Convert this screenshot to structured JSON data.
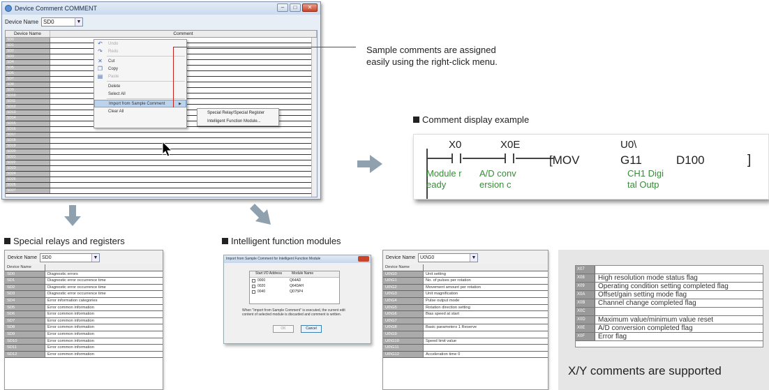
{
  "window": {
    "title": "Device Comment COMMENT",
    "device_name_label": "Device Name",
    "device_name_value": "SD0",
    "col_device": "Device Name",
    "col_comment": "Comment",
    "rows": [
      "SD0",
      "SD1",
      "SD2",
      "SD3",
      "SD4",
      "SD5",
      "SD6",
      "SD7",
      "SD8",
      "SD9",
      "SD10",
      "SD11",
      "SD12",
      "SD13",
      "SD14",
      "SD15",
      "SD16",
      "SD17",
      "SD18",
      "SD19",
      "SD20",
      "SD21",
      "SD22",
      "SD23",
      "SD24",
      "SD25",
      "SD26",
      "SD27"
    ]
  },
  "context_menu": {
    "items": [
      {
        "label": "Undo",
        "icon": "undo-icon",
        "glyph": "↶",
        "disabled": true
      },
      {
        "label": "Redo",
        "icon": "redo-icon",
        "glyph": "↷",
        "disabled": true
      },
      {
        "label": "Cut",
        "icon": "cut-icon",
        "glyph": "✕",
        "disabled": false
      },
      {
        "label": "Copy",
        "icon": "copy-icon",
        "glyph": "❐",
        "disabled": false
      },
      {
        "label": "Paste",
        "icon": "paste-icon",
        "glyph": "▤",
        "disabled": true
      },
      {
        "label": "Delete",
        "icon": "",
        "glyph": "",
        "disabled": false
      },
      {
        "label": "Select All",
        "icon": "",
        "glyph": "",
        "disabled": false
      },
      {
        "label": "Import from Sample Comment",
        "icon": "",
        "glyph": "",
        "disabled": false,
        "highlight": true
      },
      {
        "label": "Clear All",
        "icon": "",
        "glyph": "",
        "disabled": false
      }
    ],
    "submenu": [
      "Special Relay/Special Register",
      "Intelligent Function Module..."
    ]
  },
  "callout": {
    "line1": "Sample comments are assigned",
    "line2": "easily using the right-click menu."
  },
  "comment_display": {
    "title": "Comment display example",
    "x0": "X0",
    "x0e": "X0E",
    "u0": "U0\\",
    "mov": "[MOV",
    "g11": "G11",
    "d100": "D100",
    "bracket": "]",
    "c1a": "Module r",
    "c1b": "eady",
    "c2a": "A/D conv",
    "c2b": "ersion c",
    "c3a": "CH1 Digi",
    "c3b": "tal Outp"
  },
  "special": {
    "title": "Special relays and registers",
    "device_name_label": "Device Name",
    "device_name_value": "SD0",
    "col_device": "Device Name",
    "rows": [
      {
        "d": "SD0",
        "c": "Diagnostic errors"
      },
      {
        "d": "SD1",
        "c": "Diagnostic error occurrence time"
      },
      {
        "d": "SD2",
        "c": "Diagnostic error occurrence time"
      },
      {
        "d": "SD3",
        "c": "Diagnostic error occurrence time"
      },
      {
        "d": "SD4",
        "c": "Error information categories"
      },
      {
        "d": "SD5",
        "c": "Error common information"
      },
      {
        "d": "SD6",
        "c": "Error common information"
      },
      {
        "d": "SD7",
        "c": "Error common information"
      },
      {
        "d": "SD8",
        "c": "Error common information"
      },
      {
        "d": "SD9",
        "c": "Error common information"
      },
      {
        "d": "SD10",
        "c": "Error common information"
      },
      {
        "d": "SD11",
        "c": "Error common information"
      },
      {
        "d": "SD12",
        "c": "Error common information"
      }
    ]
  },
  "intelligent": {
    "title": "Intelligent function modules",
    "dialog": {
      "title": "Import from Sample Comment for Intelligent Function Module",
      "col_start": "Start I/O Address",
      "col_module": "Module Name",
      "rows": [
        {
          "s": "0000",
          "m": "Q64AD"
        },
        {
          "s": "0020",
          "m": "Q64DAH"
        },
        {
          "s": "0040",
          "m": "QD75P4"
        }
      ],
      "note": "When \"Import from Sample Comment\" is executed, the current edit content of selected module is discarded and comment is written.",
      "ok": "OK",
      "cancel": "Cancel"
    },
    "table": {
      "device_name_label": "Device Name",
      "device_name_value": "U0\\G0",
      "col_device": "Device Name",
      "rows": [
        {
          "d": "U0\\G0",
          "c": "Unit setting"
        },
        {
          "d": "U0\\G1",
          "c": "No. of pulses per rotation"
        },
        {
          "d": "U0\\G2",
          "c": "Movement amount per rotation"
        },
        {
          "d": "U0\\G3",
          "c": "Unit magnification"
        },
        {
          "d": "U0\\G4",
          "c": "Pulse output mode"
        },
        {
          "d": "U0\\G5",
          "c": "Rotation direction setting"
        },
        {
          "d": "U0\\G6",
          "c": "Bias speed at start"
        },
        {
          "d": "U0\\G7",
          "c": ""
        },
        {
          "d": "U0\\G8",
          "c": "Basic parameters 1 Reserve"
        },
        {
          "d": "U0\\G9",
          "c": ""
        },
        {
          "d": "U0\\G10",
          "c": "Speed limit value"
        },
        {
          "d": "U0\\G11",
          "c": ""
        },
        {
          "d": "U0\\G12",
          "c": "Acceleration time 0"
        }
      ]
    }
  },
  "xy": {
    "rows": [
      {
        "d": "X07",
        "c": ""
      },
      {
        "d": "X08",
        "c": "High resolution mode status flag"
      },
      {
        "d": "X09",
        "c": "Operating condition setting completed flag"
      },
      {
        "d": "X0A",
        "c": "Offset/gain setting mode flag"
      },
      {
        "d": "X0B",
        "c": "Channel change completed flag"
      },
      {
        "d": "X0C",
        "c": ""
      },
      {
        "d": "X0D",
        "c": "Maximum value/minimum value reset"
      },
      {
        "d": "X0E",
        "c": "A/D conversion completed flag"
      },
      {
        "d": "X0F",
        "c": "Error flag"
      }
    ],
    "caption": "X/Y comments are supported"
  }
}
